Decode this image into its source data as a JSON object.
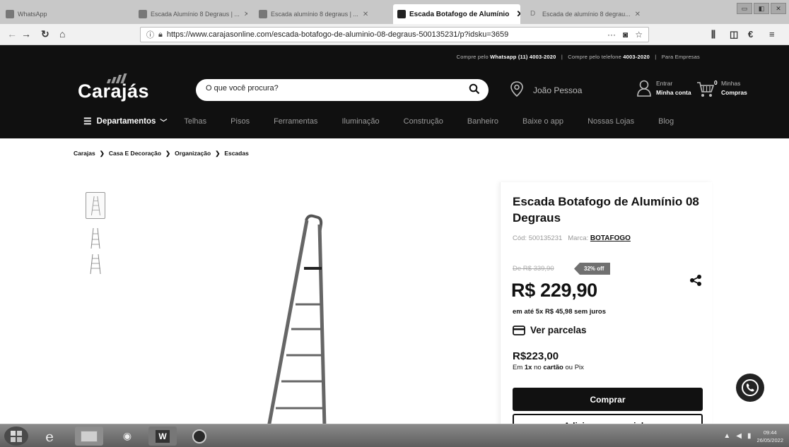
{
  "browser": {
    "tabs": [
      {
        "label": "WhatsApp",
        "active": false
      },
      {
        "label": "Escada Alumínio 8 Degraus | ...",
        "active": false
      },
      {
        "label": "Escada alumínio 8 degraus | ...",
        "active": false
      },
      {
        "label": "Escada Botafogo de Alumínio",
        "active": true
      },
      {
        "label": "Escada de alumínio 8 degrau...",
        "active": false
      }
    ],
    "url": "https://www.carajasonline.com/escada-botafogo-de-aluminio-08-degraus-500135231/p?idsku=3659",
    "url_actions": "···"
  },
  "header": {
    "topline_whatsapp_prefix": "Compre pelo",
    "topline_whatsapp": "Whatsapp (11) 4003-2020",
    "topline_phone_prefix": "Compre pelo telefone",
    "topline_phone": "4003-2020",
    "topline_companies": "Para Empresas",
    "logo": "Carajás",
    "search_placeholder": "O que você procura?",
    "location": "João Pessoa",
    "account_line1": "Entrar",
    "account_line2": "Minha conta",
    "cart_count": "0",
    "cart_line1": "Minhas",
    "cart_line2": "Compras",
    "departments": "Departamentos",
    "menu": [
      "Telhas",
      "Pisos",
      "Ferramentas",
      "Iluminação",
      "Construção",
      "Banheiro",
      "Baixe o app",
      "Nossas Lojas",
      "Blog"
    ]
  },
  "breadcrumb": [
    "Carajas",
    "Casa E Decoração",
    "Organização",
    "Escadas"
  ],
  "product": {
    "title": "Escada Botafogo de Alumínio 08 Degraus",
    "code_label": "Cód:",
    "code": "500135231",
    "brand_label": "Marca:",
    "brand": "BOTAFOGO",
    "old_price": "De R$ 339,90",
    "discount": "32% off",
    "price": "R$ 229,90",
    "installments": "em até 5x R$ 45,98 sem juros",
    "installments_link": "Ver parcelas",
    "cash_price": "R$223,00",
    "cash_note_prefix": "Em",
    "cash_note_count": "1x",
    "cash_note_middle": "no",
    "cash_note_card": "cartão",
    "cash_note_suffix": "ou Pix",
    "buy_label": "Comprar",
    "add_cart_label": "Adicionar ao carrinho"
  },
  "taskbar": {
    "clock_time": "09:44",
    "clock_date": "26/05/2022"
  },
  "colors": {
    "header_bg": "#101010",
    "button_bg": "#111111",
    "discount_bg": "#707070"
  }
}
